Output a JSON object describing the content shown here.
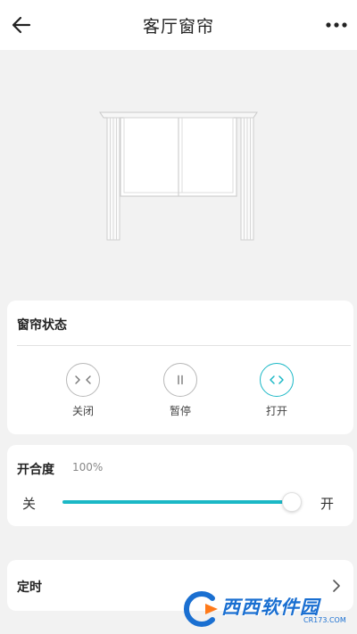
{
  "header": {
    "title": "客厅窗帘",
    "back_icon": "arrow-left-icon",
    "more_icon": "more-horizontal-icon"
  },
  "status_card": {
    "label": "窗帘状态",
    "controls": [
      {
        "label": "关闭",
        "icon": "close-curtain-icon",
        "active": false
      },
      {
        "label": "暂停",
        "icon": "pause-icon",
        "active": false
      },
      {
        "label": "打开",
        "icon": "open-curtain-icon",
        "active": true
      }
    ]
  },
  "open_card": {
    "label": "开合度",
    "value_text": "100%",
    "value": 100,
    "min_label": "关",
    "max_label": "开"
  },
  "timer_card": {
    "label": "定时",
    "icon": "chevron-right-icon"
  },
  "watermark": {
    "text": "西西软件园",
    "sub": "CR173.COM"
  },
  "colors": {
    "accent": "#1bb8c6",
    "background": "#f2f2f2",
    "card": "#ffffff"
  }
}
